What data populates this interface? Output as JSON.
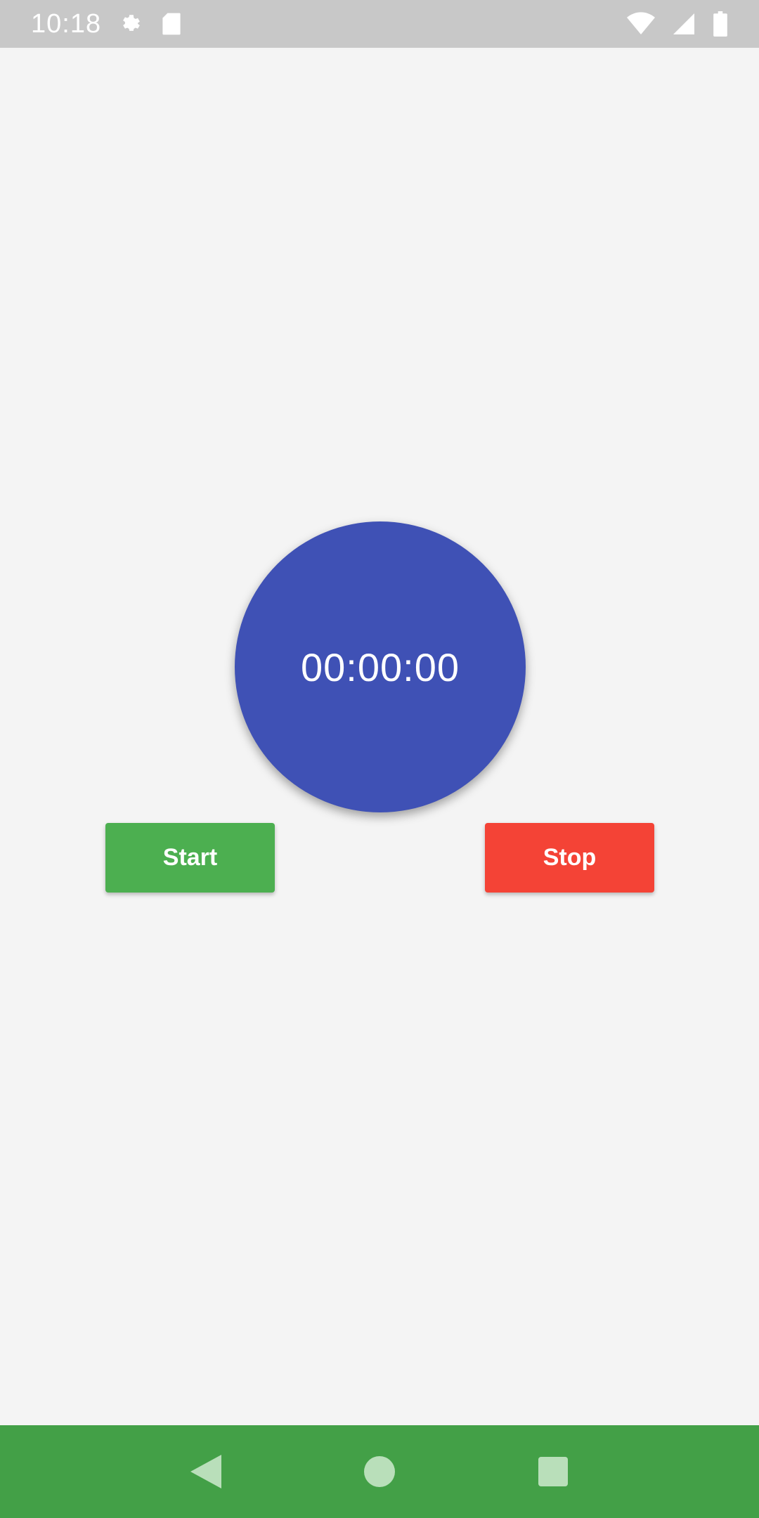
{
  "status_bar": {
    "time": "10:18",
    "icons": [
      "settings-icon",
      "sd-card-icon",
      "wifi-icon",
      "signal-icon",
      "battery-icon"
    ]
  },
  "timer": {
    "display": "00:00:00",
    "circle_color": "#3f51b5"
  },
  "buttons": {
    "start_label": "Start",
    "stop_label": "Stop",
    "start_color": "#4caf50",
    "stop_color": "#f44336"
  },
  "nav_bar": {
    "color": "#43a047",
    "icons": [
      "back-icon",
      "home-icon",
      "recents-icon"
    ]
  }
}
